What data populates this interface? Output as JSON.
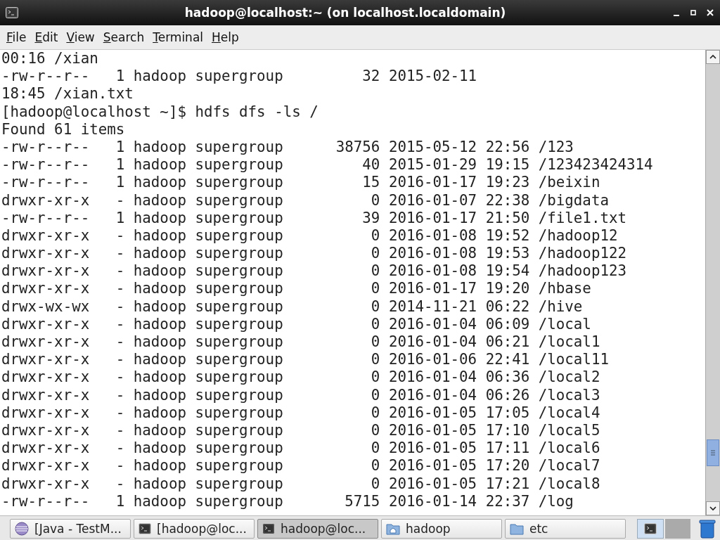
{
  "window": {
    "title": "hadoop@localhost:~ (on localhost.localdomain)"
  },
  "menu": [
    "File",
    "Edit",
    "View",
    "Search",
    "Terminal",
    "Help"
  ],
  "terminal": {
    "lines": [
      "00:16 /xian",
      "-rw-r--r--   1 hadoop supergroup         32 2015-02-11",
      "18:45 /xian.txt",
      "[hadoop@localhost ~]$ hdfs dfs -ls /",
      "Found 61 items",
      "-rw-r--r--   1 hadoop supergroup      38756 2015-05-12 22:56 /123",
      "-rw-r--r--   1 hadoop supergroup         40 2015-01-29 19:15 /123423424314",
      "-rw-r--r--   1 hadoop supergroup         15 2016-01-17 19:23 /beixin",
      "drwxr-xr-x   - hadoop supergroup          0 2016-01-07 22:38 /bigdata",
      "-rw-r--r--   1 hadoop supergroup         39 2016-01-17 21:50 /file1.txt",
      "drwxr-xr-x   - hadoop supergroup          0 2016-01-08 19:52 /hadoop12",
      "drwxr-xr-x   - hadoop supergroup          0 2016-01-08 19:53 /hadoop122",
      "drwxr-xr-x   - hadoop supergroup          0 2016-01-08 19:54 /hadoop123",
      "drwxr-xr-x   - hadoop supergroup          0 2016-01-17 19:20 /hbase",
      "drwx-wx-wx   - hadoop supergroup          0 2014-11-21 06:22 /hive",
      "drwxr-xr-x   - hadoop supergroup          0 2016-01-04 06:09 /local",
      "drwxr-xr-x   - hadoop supergroup          0 2016-01-04 06:21 /local1",
      "drwxr-xr-x   - hadoop supergroup          0 2016-01-06 22:41 /local11",
      "drwxr-xr-x   - hadoop supergroup          0 2016-01-04 06:36 /local2",
      "drwxr-xr-x   - hadoop supergroup          0 2016-01-04 06:26 /local3",
      "drwxr-xr-x   - hadoop supergroup          0 2016-01-05 17:05 /local4",
      "drwxr-xr-x   - hadoop supergroup          0 2016-01-05 17:10 /local5",
      "drwxr-xr-x   - hadoop supergroup          0 2016-01-05 17:11 /local6",
      "drwxr-xr-x   - hadoop supergroup          0 2016-01-05 17:20 /local7",
      "drwxr-xr-x   - hadoop supergroup          0 2016-01-05 17:21 /local8",
      "-rw-r--r--   1 hadoop supergroup       5715 2016-01-14 22:37 /log"
    ]
  },
  "taskbar": {
    "items": [
      {
        "kind": "ide",
        "label": "[Java - TestM...",
        "selected": false
      },
      {
        "kind": "terminal",
        "label": "[hadoop@loc...",
        "selected": false
      },
      {
        "kind": "terminal",
        "label": "hadoop@loc...",
        "selected": true
      },
      {
        "kind": "home",
        "label": "hadoop",
        "selected": false
      },
      {
        "kind": "folder",
        "label": "etc",
        "selected": false
      }
    ]
  }
}
